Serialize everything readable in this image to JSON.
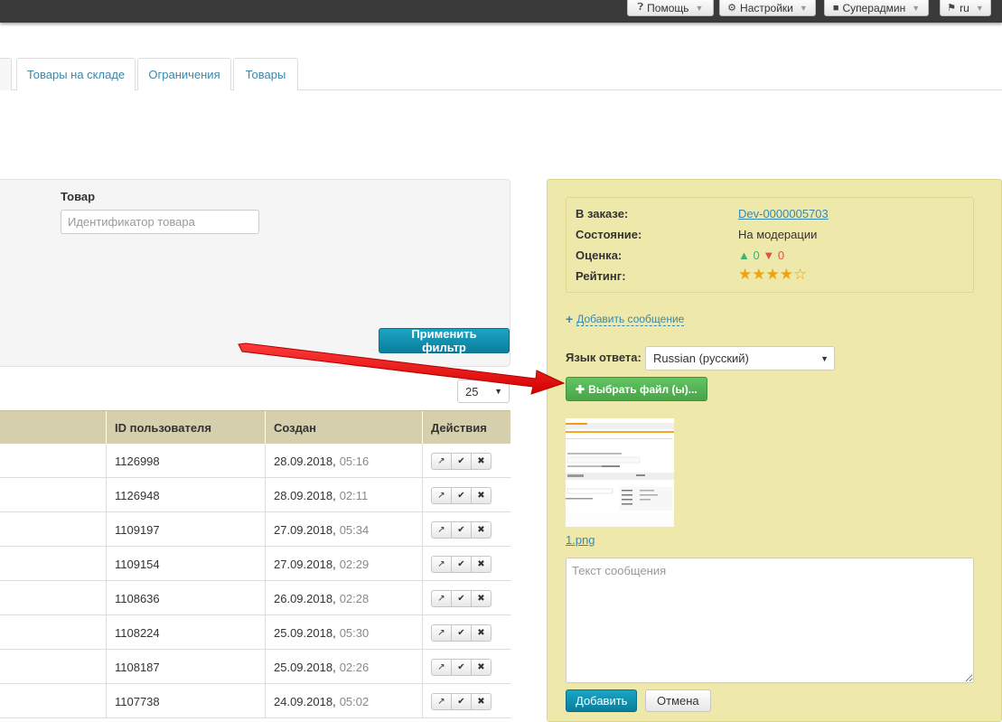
{
  "topbar": {
    "help_label": "Помощь",
    "settings_label": "Настройки",
    "user_label": "Суперадмин",
    "lang_label": "ru"
  },
  "tabs": [
    {
      "label": ""
    },
    {
      "label": "Товары на складе"
    },
    {
      "label": "Ограничения"
    },
    {
      "label": "Товары"
    }
  ],
  "filter": {
    "product_label": "Товар",
    "product_placeholder": "Идентификатор товара",
    "apply_label": "Применить фильтр"
  },
  "pagination": {
    "page_size": "25"
  },
  "table": {
    "headers": {
      "user_id": "ID пользователя",
      "created": "Создан",
      "actions": "Действия"
    },
    "rows": [
      {
        "user_id": "1126998",
        "date": "28.09.2018,",
        "time": "05:16"
      },
      {
        "user_id": "1126948",
        "date": "28.09.2018,",
        "time": "02:11"
      },
      {
        "user_id": "1109197",
        "date": "27.09.2018,",
        "time": "05:34"
      },
      {
        "user_id": "1109154",
        "date": "27.09.2018,",
        "time": "02:29"
      },
      {
        "user_id": "1108636",
        "date": "26.09.2018,",
        "time": "02:28"
      },
      {
        "user_id": "1108224",
        "date": "25.09.2018,",
        "time": "05:30"
      },
      {
        "user_id": "1108187",
        "date": "25.09.2018,",
        "time": "02:26"
      },
      {
        "user_id": "1107738",
        "date": "24.09.2018,",
        "time": "05:02"
      }
    ]
  },
  "details": {
    "order_label": "В заказе:",
    "order_value": "Dev-0000005703",
    "state_label": "Состояние:",
    "state_value": "На модерации",
    "score_label": "Оценка:",
    "score_up": "0",
    "score_down": "0",
    "rating_label": "Рейтинг:",
    "rating": 4,
    "rating_max": 5
  },
  "reply": {
    "add_message": "Добавить сообщение",
    "lang_label": "Язык ответа:",
    "lang_value": "Russian (русский)",
    "choose_file": "Выбрать файл (ы)...",
    "attachment_name": "1.png",
    "message_placeholder": "Текст сообщения",
    "submit_label": "Добавить",
    "cancel_label": "Отмена"
  },
  "colors": {
    "accent": "#0e8cab",
    "right_panel_bg": "#eee8aa",
    "table_header_bg": "#d6cfae",
    "success": "#48a548",
    "arrow": "#e8000b"
  }
}
